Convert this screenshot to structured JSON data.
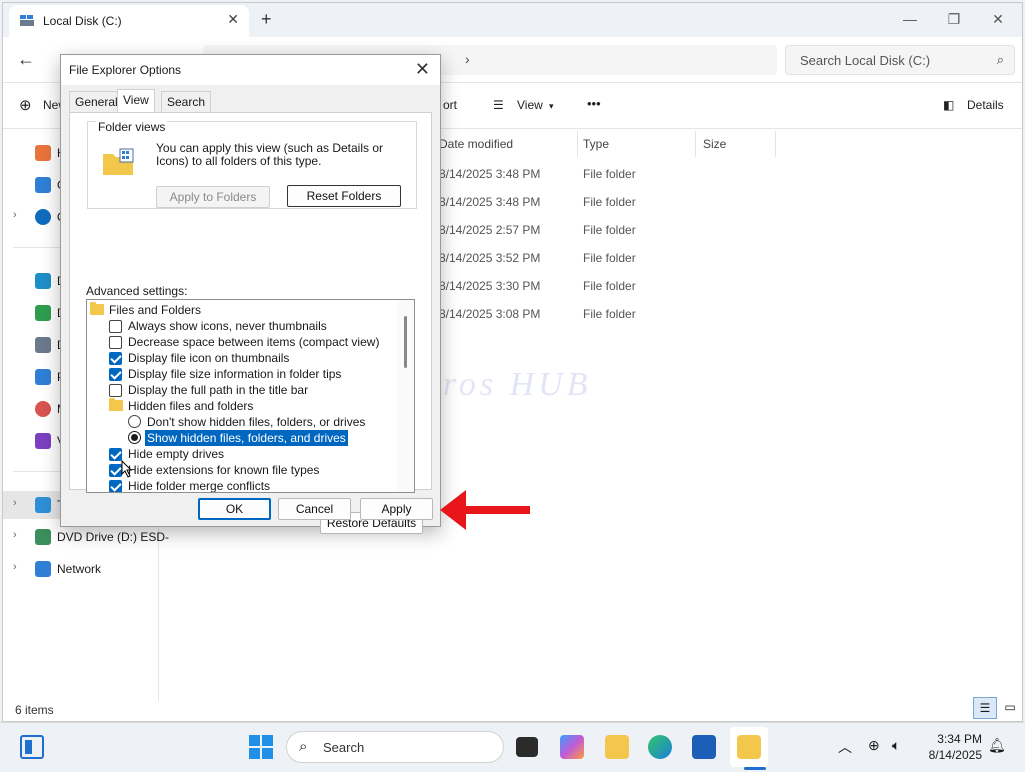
{
  "explorer": {
    "tab_title": "Local Disk (C:)",
    "search_placeholder": "Search Local Disk (C:)",
    "cmd_new": "New",
    "cmd_sort": "ort",
    "cmd_view": "View",
    "cmd_more": "•••",
    "cmd_details": "Details",
    "columns": {
      "date": "Date modified",
      "type": "Type",
      "size": "Size"
    },
    "rows": [
      {
        "date": "8/14/2025 3:48 PM",
        "type": "File folder"
      },
      {
        "date": "8/14/2025 3:48 PM",
        "type": "File folder"
      },
      {
        "date": "8/14/2025 2:57 PM",
        "type": "File folder"
      },
      {
        "date": "8/14/2025 3:52 PM",
        "type": "File folder"
      },
      {
        "date": "8/14/2025 3:30 PM",
        "type": "File folder"
      },
      {
        "date": "8/14/2025 3:08 PM",
        "type": "File folder"
      }
    ],
    "nav": [
      {
        "label": "H",
        "color": "#e8743b"
      },
      {
        "label": "G",
        "color": "#2f7fd6"
      },
      {
        "label": "O",
        "color": "#0f6cbd"
      },
      {
        "label": "D",
        "color": "#1f8fc9"
      },
      {
        "label": "D",
        "color": "#2e9e4e"
      },
      {
        "label": "D",
        "color": "#6b7a8c"
      },
      {
        "label": "P",
        "color": "#2f7fd6"
      },
      {
        "label": "M",
        "color": "#d9534f"
      },
      {
        "label": "V",
        "color": "#7b3fbf"
      },
      {
        "label": "T",
        "color": "#2d8fd6"
      },
      {
        "label": "DVD Drive (D:) ESD-",
        "color": "#3a8f5c"
      },
      {
        "label": "Network",
        "color": "#2f7fd6"
      }
    ],
    "status": "6 items"
  },
  "watermark": "IT Pros HUB",
  "dialog": {
    "title": "File Explorer Options",
    "tabs": [
      "General",
      "View",
      "Search"
    ],
    "folder_views": {
      "legend": "Folder views",
      "description": "You can apply this view (such as Details or Icons) to all folders of this type.",
      "apply_btn": "Apply to Folders",
      "reset_btn": "Reset Folders"
    },
    "advanced_label": "Advanced settings:",
    "items": [
      {
        "kind": "folder",
        "label": "Files and Folders"
      },
      {
        "kind": "check",
        "checked": false,
        "label": "Always show icons, never thumbnails"
      },
      {
        "kind": "check",
        "checked": false,
        "label": "Decrease space between items (compact view)"
      },
      {
        "kind": "check",
        "checked": true,
        "label": "Display file icon on thumbnails"
      },
      {
        "kind": "check",
        "checked": true,
        "label": "Display file size information in folder tips"
      },
      {
        "kind": "check",
        "checked": false,
        "label": "Display the full path in the title bar"
      },
      {
        "kind": "folder",
        "label": "Hidden files and folders"
      },
      {
        "kind": "radio",
        "checked": false,
        "label": "Don't show hidden files, folders, or drives"
      },
      {
        "kind": "radio",
        "checked": true,
        "label": "Show hidden files, folders, and drives"
      },
      {
        "kind": "check",
        "checked": true,
        "label": "Hide empty drives"
      },
      {
        "kind": "check",
        "checked": true,
        "label": "Hide extensions for known file types"
      },
      {
        "kind": "check",
        "checked": true,
        "label": "Hide folder merge conflicts"
      }
    ],
    "restore_btn": "Restore Defaults",
    "ok_btn": "OK",
    "cancel_btn": "Cancel",
    "apply_btn": "Apply"
  },
  "taskbar": {
    "search_placeholder": "Search",
    "time": "3:34 PM",
    "date": "8/14/2025"
  }
}
